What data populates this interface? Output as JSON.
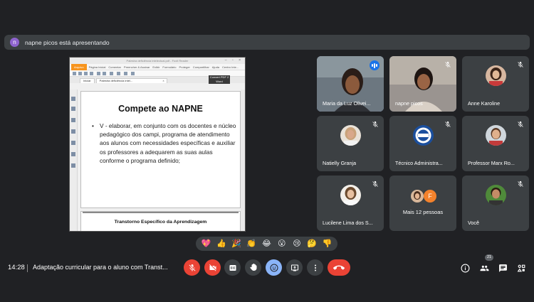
{
  "presenting": {
    "avatar_letter": "n",
    "text": "napne picos está apresentando"
  },
  "shared_screen": {
    "window_title": "Palestra deficiência intelectual.pdf - Foxit Reader",
    "menu": [
      "Arquivo",
      "Página Inicial",
      "Comentar",
      "Preencher & Assinar",
      "Exibir",
      "Formulário",
      "Proteger",
      "Compartilhar",
      "Ajuda"
    ],
    "menu_extra": "Centro Inte...",
    "convert_label": "Convert PDF 2 Word",
    "tabs": [
      "Iniciar",
      "Palestra deficiência intel..."
    ],
    "slide_title": "Compete ao NAPNE",
    "bullet": "•",
    "slide_body": "V - elaborar, em conjunto com os docentes e núcleo pedagógico dos campi, programa de atendimento aos alunos com necessidades específicas e auxiliar os professores a adequarem as suas aulas conforme o programa definido;",
    "next_slide_title": "Transtorno Específico da Aprendizagem"
  },
  "participants": [
    {
      "name": "Maria da Luz Olivei...",
      "type": "video"
    },
    {
      "name": "napne picos",
      "type": "video"
    },
    {
      "name": "Anne Karoline",
      "type": "avatar"
    },
    {
      "name": "Natielly Granja",
      "type": "avatar"
    },
    {
      "name": "Técnico Administra...",
      "type": "avatar"
    },
    {
      "name": "Professor Marx Ro...",
      "type": "avatar"
    },
    {
      "name": "Lucilene Lima dos S...",
      "type": "avatar"
    },
    {
      "name": "Mais 12 pessoas",
      "type": "more",
      "letter": "F"
    },
    {
      "name": "Você",
      "type": "avatar"
    }
  ],
  "reactions": [
    "💖",
    "👍",
    "🎉",
    "👏",
    "😂",
    "😮",
    "😢",
    "🤔",
    "👎"
  ],
  "bottom": {
    "time": "14:28",
    "meeting_title": "Adaptação curricular para o aluno com Transt...",
    "people_count": "21"
  },
  "colors": {
    "background": "#202124",
    "tile": "#3c4043",
    "red": "#ea4335",
    "accent": "#8ab4f8"
  }
}
